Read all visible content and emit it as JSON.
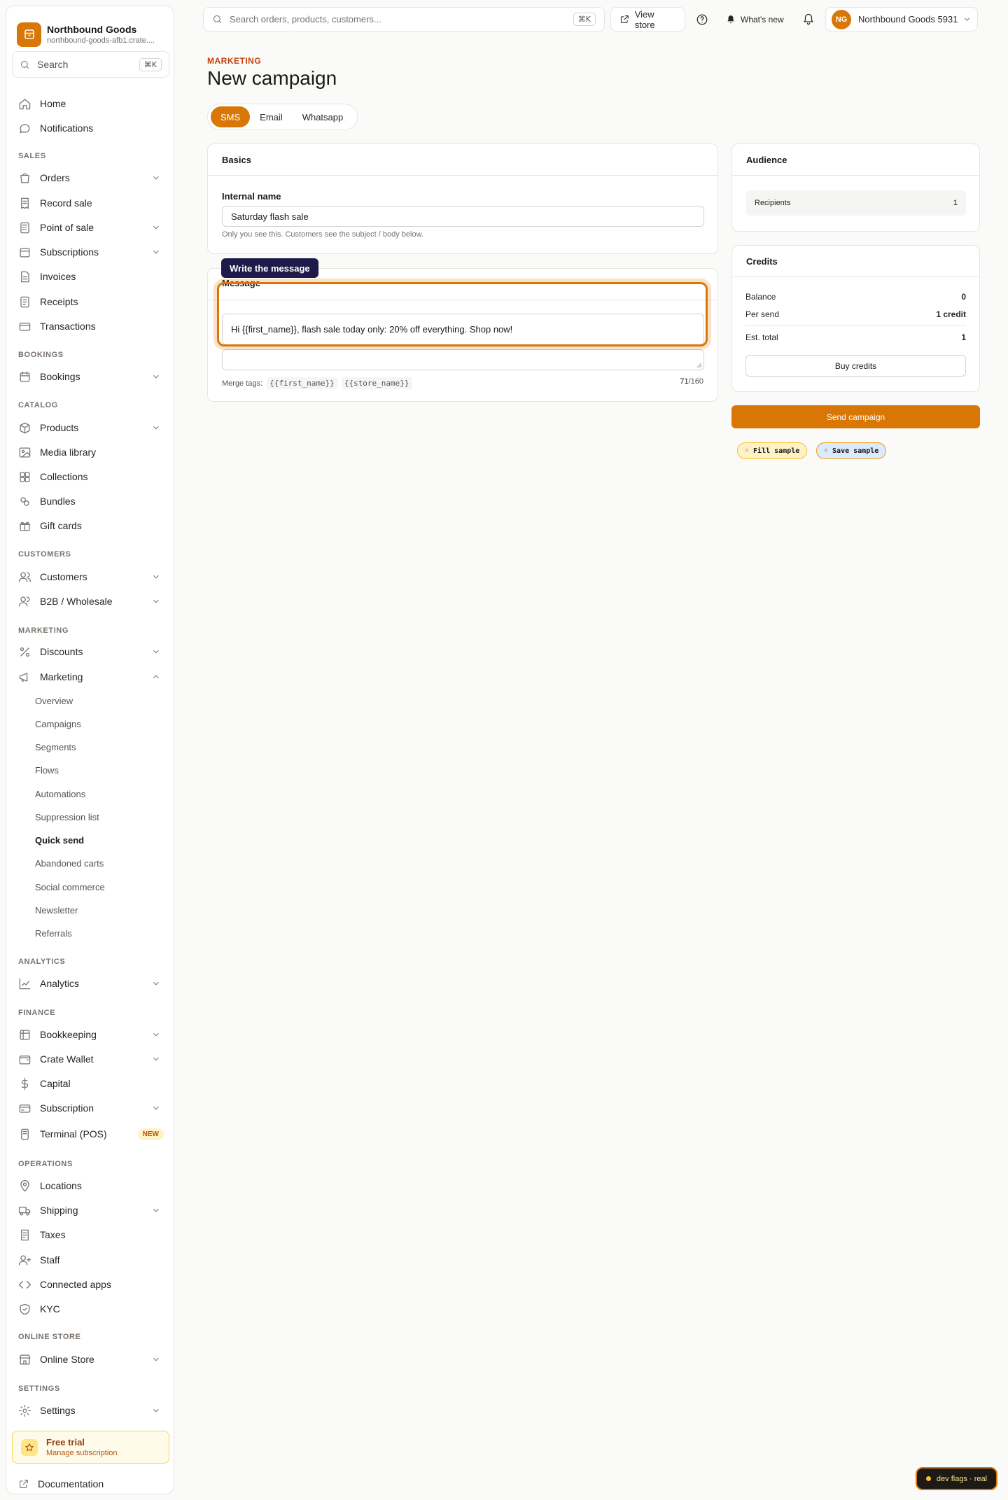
{
  "brand": {
    "name": "Northbound Goods",
    "domain": "northbound-goods-afb1.crate...."
  },
  "sidebar": {
    "search_label": "Search",
    "search_kbd": "⌘K",
    "items": {
      "home": "Home",
      "notifications": "Notifications",
      "orders": "Orders",
      "record_sale": "Record sale",
      "point_of_sale": "Point of sale",
      "subscriptions": "Subscriptions",
      "invoices": "Invoices",
      "receipts": "Receipts",
      "transactions": "Transactions",
      "bookings": "Bookings",
      "products": "Products",
      "media_library": "Media library",
      "collections": "Collections",
      "bundles": "Bundles",
      "gift_cards": "Gift cards",
      "customers": "Customers",
      "b2b": "B2B / Wholesale",
      "discounts": "Discounts",
      "marketing": "Marketing",
      "analytics": "Analytics",
      "bookkeeping": "Bookkeeping",
      "crate_wallet": "Crate Wallet",
      "capital": "Capital",
      "subscription": "Subscription",
      "terminal": "Terminal (POS)",
      "locations": "Locations",
      "shipping": "Shipping",
      "taxes": "Taxes",
      "staff": "Staff",
      "connected_apps": "Connected apps",
      "kyc": "KYC",
      "online_store": "Online Store",
      "settings": "Settings"
    },
    "sections": {
      "sales": "SALES",
      "bookings": "BOOKINGS",
      "catalog": "CATALOG",
      "customers": "CUSTOMERS",
      "marketing": "MARKETING",
      "analytics": "ANALYTICS",
      "finance": "FINANCE",
      "operations": "OPERATIONS",
      "online_store": "ONLINE STORE",
      "settings": "SETTINGS"
    },
    "marketing_sub": {
      "overview": "Overview",
      "campaigns": "Campaigns",
      "segments": "Segments",
      "flows": "Flows",
      "automations": "Automations",
      "suppression": "Suppression list",
      "quick_send": "Quick send",
      "abandoned": "Abandoned carts",
      "social": "Social commerce",
      "newsletter": "Newsletter",
      "referrals": "Referrals"
    },
    "new_badge": "NEW",
    "trial_title": "Free trial",
    "trial_sub": "Manage subscription",
    "documentation": "Documentation"
  },
  "topbar": {
    "search_placeholder": "Search orders, products, customers...",
    "search_kbd": "⌘K",
    "view_store": "View store",
    "whats_new": "What's new",
    "account_initials": "NG",
    "account_name": "Northbound Goods 5931"
  },
  "page": {
    "eyebrow": "MARKETING",
    "title": "New campaign",
    "channels": [
      "SMS",
      "Email",
      "Whatsapp"
    ],
    "basics": {
      "heading": "Basics",
      "internal_name_label": "Internal name",
      "internal_name_value": "Saturday flash sale",
      "help": "Only you see this. Customers see the subject / body below."
    },
    "message": {
      "tooltip": "Write the message",
      "heading": "Message",
      "value": "Hi {{first_name}}, flash sale today only: 20% off everything. Shop now!",
      "merge_label": "Merge tags:",
      "merge_tags": [
        "{{first_name}}",
        "{{store_name}}"
      ],
      "count": "71",
      "limit": "/160"
    },
    "audience": {
      "heading": "Audience",
      "recipients_label": "Recipients",
      "recipients_value": "1"
    },
    "credits": {
      "heading": "Credits",
      "balance_label": "Balance",
      "balance_value": "0",
      "per_send_label": "Per send",
      "per_send_value": "1 credit",
      "est_total_label": "Est. total",
      "est_total_value": "1",
      "buy": "Buy credits"
    },
    "send": "Send campaign",
    "fill_sample": "Fill sample",
    "save_sample": "Save sample"
  },
  "dev_flags": "dev flags · real",
  "colors": {
    "accent": "#d97706",
    "tooltip_bg": "#1e1b4b"
  }
}
